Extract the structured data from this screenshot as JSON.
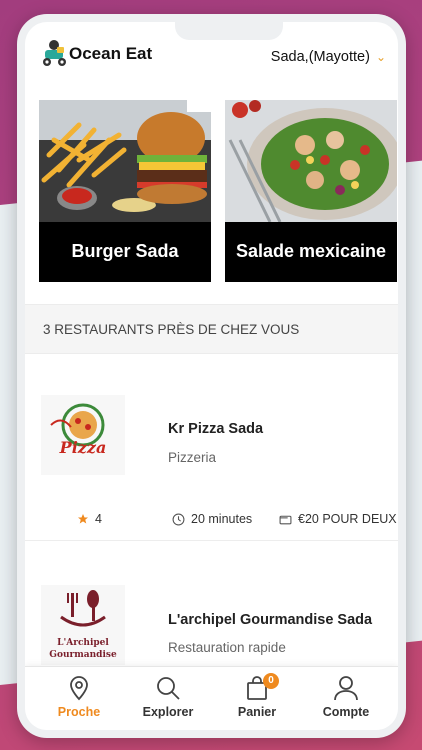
{
  "header": {
    "app_title": "Ocean Eat",
    "location": "Sada,(Mayotte)"
  },
  "promos": [
    {
      "label": "Burger Sada"
    },
    {
      "label": "Salade mexicaine"
    }
  ],
  "section_title": "3 RESTAURANTS PRÈS DE CHEZ VOUS",
  "restaurants": [
    {
      "name": "Kr Pizza Sada",
      "category": "Pizzeria",
      "rating": "4",
      "delivery_time": "20 minutes",
      "price": "€20 POUR DEUX",
      "logo_text": "Pizza"
    },
    {
      "name": "L'archipel Gourmandise Sada",
      "category": "Restauration rapide",
      "logo_text_1": "L'Archipel",
      "logo_text_2": "Gourmandise"
    }
  ],
  "nav": [
    {
      "label": "Proche",
      "icon": "location-pin-icon",
      "active": true
    },
    {
      "label": "Explorer",
      "icon": "search-icon"
    },
    {
      "label": "Panier",
      "icon": "shopping-bag-icon",
      "badge": "0"
    },
    {
      "label": "Compte",
      "icon": "user-icon"
    }
  ],
  "colors": {
    "accent": "#ef8a1f",
    "location_chevron": "#e7a12b",
    "caption_background": "#000000"
  }
}
